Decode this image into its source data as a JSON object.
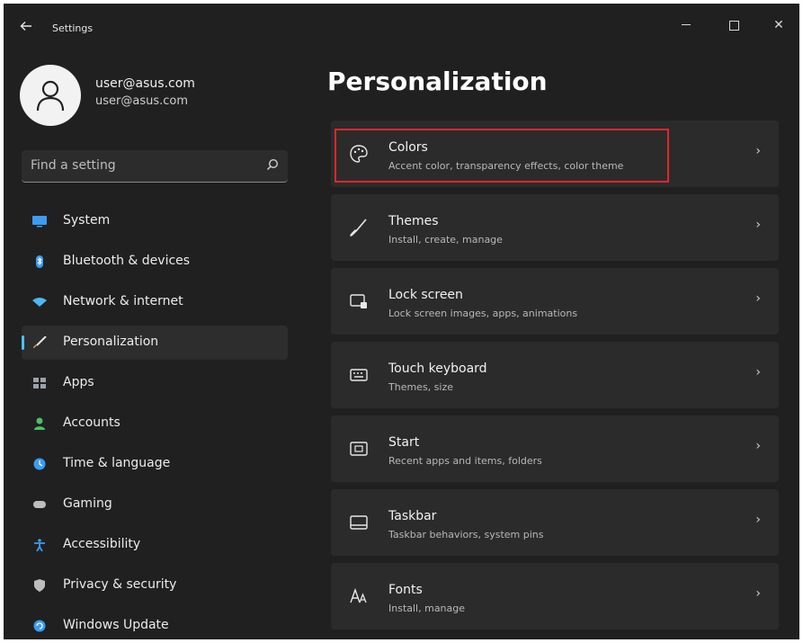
{
  "window": {
    "title": "Settings",
    "back_icon": "back-arrow-icon",
    "minimize_icon": "minimize-icon",
    "maximize_icon": "maximize-icon",
    "close_glyph": "✕"
  },
  "profile": {
    "name": "user@asus.com",
    "email": "user@asus.com",
    "avatar_icon": "person-icon"
  },
  "search": {
    "placeholder": "Find a setting",
    "icon": "search-icon"
  },
  "sidebar": {
    "items": [
      {
        "label": "System",
        "icon": "system-icon",
        "color": "#3b9cf0"
      },
      {
        "label": "Bluetooth & devices",
        "icon": "bluetooth-icon",
        "color": "#3b9cf0"
      },
      {
        "label": "Network & internet",
        "icon": "network-icon",
        "color": "#4cb8f2"
      },
      {
        "label": "Personalization",
        "icon": "brush-icon",
        "color": "#e49b5a",
        "active": true
      },
      {
        "label": "Apps",
        "icon": "apps-icon",
        "color": "#9aa3ad"
      },
      {
        "label": "Accounts",
        "icon": "accounts-icon",
        "color": "#4fbf6a"
      },
      {
        "label": "Time & language",
        "icon": "time-language-icon",
        "color": "#3b9cf0"
      },
      {
        "label": "Gaming",
        "icon": "gaming-icon",
        "color": "#bdbdbd"
      },
      {
        "label": "Accessibility",
        "icon": "accessibility-icon",
        "color": "#3b9cf0"
      },
      {
        "label": "Privacy & security",
        "icon": "shield-icon",
        "color": "#bdbdbd"
      },
      {
        "label": "Windows Update",
        "icon": "windows-update-icon",
        "color": "#3b9cf0"
      }
    ],
    "accent": "#4cc2ff"
  },
  "main": {
    "title": "Personalization",
    "cards": [
      {
        "title": "Colors",
        "subtitle": "Accent color, transparency effects, color theme",
        "icon": "palette-icon",
        "highlighted": true
      },
      {
        "title": "Themes",
        "subtitle": "Install, create, manage",
        "icon": "brush-icon"
      },
      {
        "title": "Lock screen",
        "subtitle": "Lock screen images, apps, animations",
        "icon": "lock-screen-icon"
      },
      {
        "title": "Touch keyboard",
        "subtitle": "Themes, size",
        "icon": "keyboard-icon"
      },
      {
        "title": "Start",
        "subtitle": "Recent apps and items, folders",
        "icon": "start-icon"
      },
      {
        "title": "Taskbar",
        "subtitle": "Taskbar behaviors, system pins",
        "icon": "taskbar-icon"
      },
      {
        "title": "Fonts",
        "subtitle": "Install, manage",
        "icon": "fonts-icon"
      }
    ],
    "chevron": "›",
    "highlight_color": "#e0262b"
  }
}
